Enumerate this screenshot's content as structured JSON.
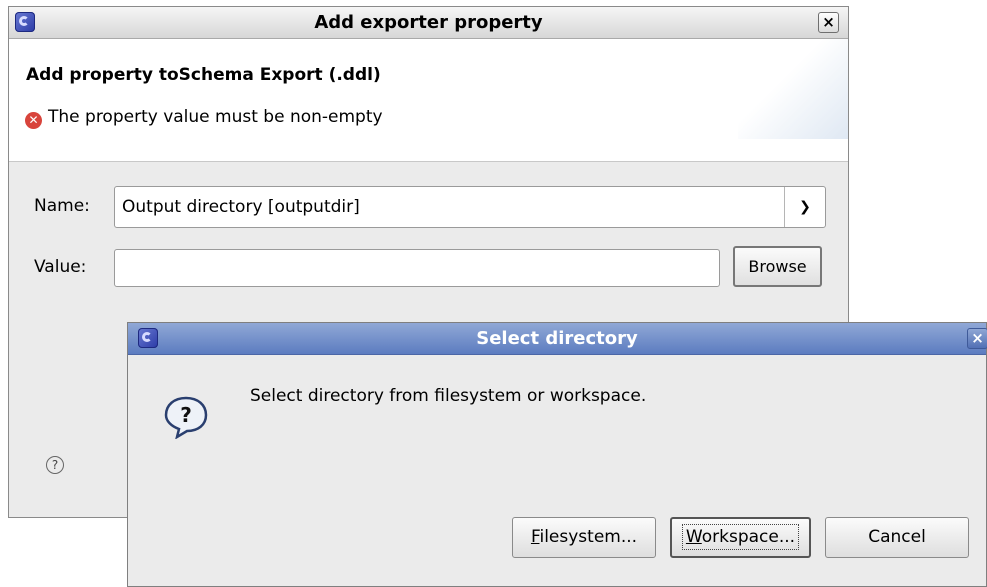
{
  "window1": {
    "title": "Add exporter property",
    "close_label": "×",
    "header_title": "Add property toSchema Export (.ddl)",
    "error_message": "The property value must be non-empty",
    "name_label": "Name:",
    "name_value": "Output directory [outputdir]",
    "value_label": "Value:",
    "value_value": "",
    "browse_label": "Browse",
    "help_glyph": "?"
  },
  "window2": {
    "title": "Select directory",
    "close_label": "×",
    "message": "Select directory from filesystem or workspace.",
    "buttons": {
      "filesystem_mnemonic": "F",
      "filesystem_rest": "ilesystem...",
      "workspace_mnemonic": "W",
      "workspace_rest": "orkspace...",
      "cancel": "Cancel"
    }
  },
  "icons": {
    "app": "eclipse-icon",
    "error": "error-icon",
    "question": "question-icon",
    "help": "help-icon",
    "dropdown": "chevron-down-icon"
  },
  "colors": {
    "error_red": "#d8443c",
    "active_title_blue": "#5c7cc0"
  }
}
